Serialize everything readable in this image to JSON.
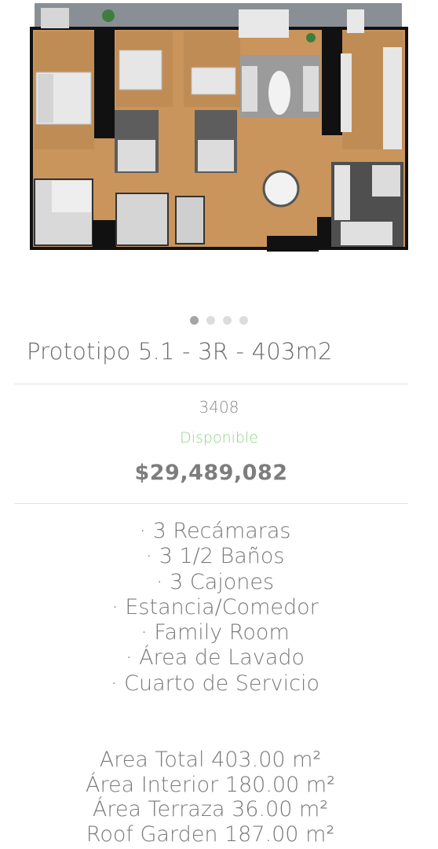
{
  "gallery": {
    "slide_count": 4,
    "active_index": 0
  },
  "listing": {
    "title": "Prototipo 5.1 - 3R - 403m2",
    "unit_number": "3408",
    "status": "Disponible",
    "price": "$29,489,082"
  },
  "features": [
    "· 3 Recámaras",
    "· 3 1/2 Baños",
    "· 3 Cajones",
    "· Estancia/Comedor",
    "· Family Room",
    "· Área de Lavado",
    "· Cuarto de Servicio"
  ],
  "areas": [
    "Area Total 403.00 m²",
    "Área Interior 180.00 m²",
    "Área Terraza 36.00 m²",
    "Roof Garden 187.00 m²"
  ],
  "colors": {
    "wood_floor": "#c9955c",
    "wall": "#111111",
    "terrace": "#8a8f96",
    "status_green": "#8fd28a"
  }
}
